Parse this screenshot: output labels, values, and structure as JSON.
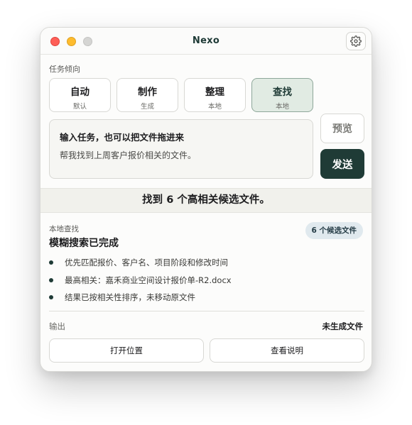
{
  "window": {
    "title": "Nexo"
  },
  "icons": {
    "settings": "gear-icon"
  },
  "task_mode": {
    "label": "任务倾向",
    "modes": [
      {
        "label": "自动",
        "sub": "默认",
        "active": false
      },
      {
        "label": "制作",
        "sub": "生成",
        "active": false
      },
      {
        "label": "整理",
        "sub": "本地",
        "active": false
      },
      {
        "label": "查找",
        "sub": "本地",
        "active": true
      }
    ]
  },
  "task_input": {
    "title": "输入任务，也可以把文件拖进来",
    "text": "帮我找到上周客户报价相关的文件。"
  },
  "actions": {
    "preview": "预览",
    "send": "发送"
  },
  "result": {
    "banner": "找到 6 个高相关候选文件。",
    "status_label": "本地查找",
    "status_title": "模糊搜索已完成",
    "count_badge": "6 个候选文件",
    "bullets": [
      "优先匹配报价、客户名、项目阶段和修改时间",
      "最高相关：嘉禾商业空间设计报价单-R2.docx",
      "结果已按相关性排序，未移动原文件"
    ]
  },
  "output": {
    "label": "输出",
    "value": "未生成文件",
    "open_button": "打开位置",
    "explain_button": "查看说明"
  },
  "colors": {
    "accent": "#1f3b36",
    "active_mode_bg": "#e1ebe3",
    "badge_bg": "#e0e9ee"
  }
}
